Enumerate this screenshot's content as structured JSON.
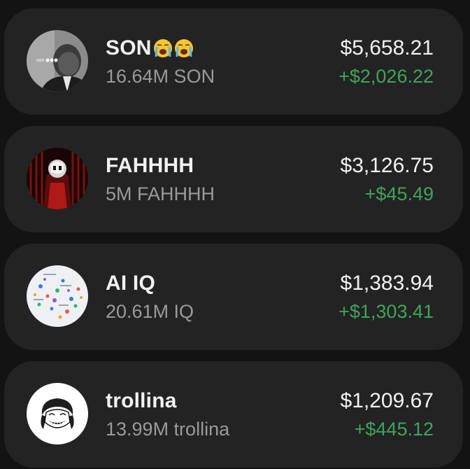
{
  "colors": {
    "background": "#131313",
    "card": "#232323",
    "primary_text": "#f2f2f2",
    "secondary_text": "#9a9a9a",
    "positive": "#3fa45a"
  },
  "tokens": [
    {
      "name": "SON",
      "emoji": [
        "loudly-crying-face-icon",
        "loudly-crying-face-icon"
      ],
      "amount": "16.64M SON",
      "value": "$5,658.21",
      "change": "+$2,026.22",
      "avatar_caption": "son"
    },
    {
      "name": "FAHHHH",
      "emoji": [],
      "amount": "5M FAHHHH",
      "value": "$3,126.75",
      "change": "+$45.49"
    },
    {
      "name": "AI IQ",
      "emoji": [],
      "amount": "20.61M IQ",
      "value": "$1,383.94",
      "change": "+$1,303.41"
    },
    {
      "name": "trollina",
      "emoji": [],
      "amount": "13.99M trollina",
      "value": "$1,209.67",
      "change": "+$445.12"
    }
  ]
}
